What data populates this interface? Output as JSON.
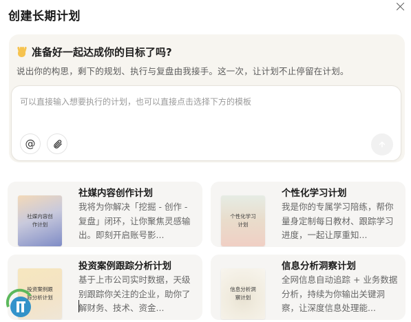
{
  "dialog": {
    "title": "创建长期计划"
  },
  "hero": {
    "heading": "准备好一起达成你的目标了吗?",
    "subtitle": "说出你的构思，剩下的规划、执行与复盘由我接手。这一次，让计划不止停留在计划。"
  },
  "composer": {
    "placeholder": "可以直接输入想要执行的计划，也可以直接点击选择下方的模板",
    "mention_icon": "@",
    "attach_icon": "paperclip-icon",
    "send_icon": "arrow-up-icon"
  },
  "templates": [
    {
      "title": "社媒内容创作计划",
      "desc": "我将为你解决「挖掘 - 创作 - 复盘」闭环，让你聚焦灵感输出。即刻开启账号影...",
      "thumb_text": "社媒内容创作计划"
    },
    {
      "title": "个性化学习计划",
      "desc": "我是你的专属学习陪练，帮你量身定制每日教材、跟踪学习进度，一起让厚重知...",
      "thumb_text": "个性化学习计划"
    },
    {
      "title": "投资案例跟踪分析计划",
      "desc": "基于上市公司实时数据，天级别跟踪你关注的企业，助你了解财务、技术、资金...",
      "thumb_text": "投资案例跟踪分析计划"
    },
    {
      "title": "信息分析洞察计划",
      "desc": "全网信息自动追踪 + 业务数据分析，持续为你输出关键洞察，让深度信息处理能...",
      "thumb_text": "信息分析洞察计划"
    }
  ],
  "colors": {
    "hero_bg": "#f7f5f0",
    "card_bg": "#f6f5f3",
    "accent_wave": "#f6c34f"
  }
}
